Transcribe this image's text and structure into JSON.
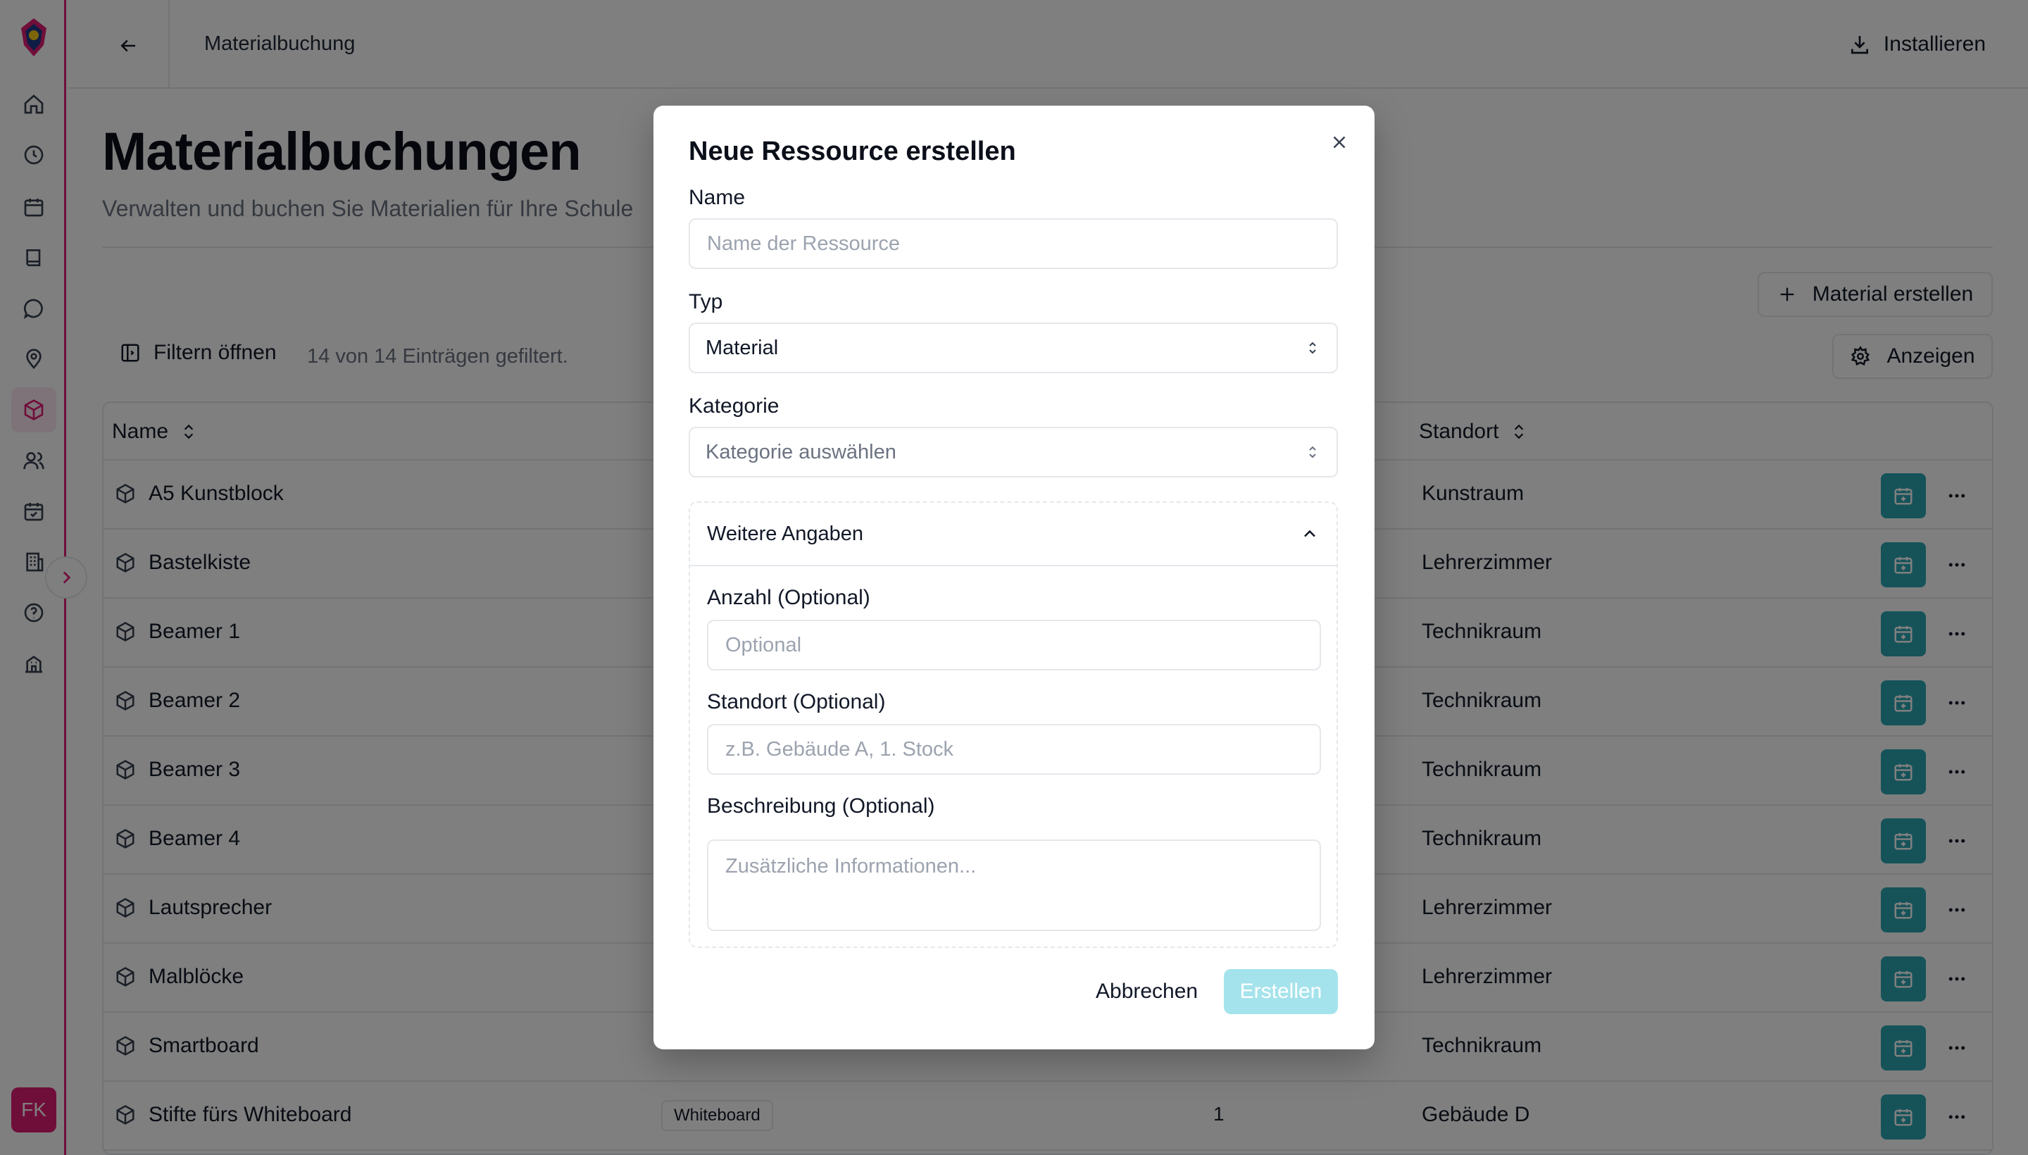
{
  "topbar": {
    "title": "Materialbuchung",
    "install_label": "Installieren"
  },
  "page": {
    "title": "Materialbuchungen",
    "subtitle": "Verwalten und buchen Sie Materialien für Ihre Schule",
    "create_material_label": "Material erstellen",
    "filter_label": "Filtern öffnen",
    "filter_info": "14 von 14 Einträgen gefiltert.",
    "display_label": "Anzeigen"
  },
  "user": {
    "initials": "FK"
  },
  "table": {
    "headers": {
      "name": "Name",
      "location": "Standort"
    },
    "rows": [
      {
        "name": "A5 Kunstblock",
        "location": "Kunstraum"
      },
      {
        "name": "Bastelkiste",
        "location": "Lehrerzimmer"
      },
      {
        "name": "Beamer 1",
        "location": "Technikraum"
      },
      {
        "name": "Beamer 2",
        "location": "Technikraum"
      },
      {
        "name": "Beamer 3",
        "location": "Technikraum"
      },
      {
        "name": "Beamer 4",
        "location": "Technikraum"
      },
      {
        "name": "Lautsprecher",
        "location": "Lehrerzimmer"
      },
      {
        "name": "Malblöcke",
        "location": "Lehrerzimmer"
      },
      {
        "name": "Smartboard",
        "location": "Technikraum"
      },
      {
        "name": "Stifte fürs Whiteboard",
        "type": "Whiteboard",
        "quantity": "1",
        "location": "Gebäude D"
      }
    ]
  },
  "modal": {
    "title": "Neue Ressource erstellen",
    "name_label": "Name",
    "name_placeholder": "Name der Ressource",
    "type_label": "Typ",
    "type_value": "Material",
    "category_label": "Kategorie",
    "category_placeholder": "Kategorie auswählen",
    "details_title": "Weitere Angaben",
    "quantity_label": "Anzahl  (Optional)",
    "quantity_placeholder": "Optional",
    "location_label": "Standort  (Optional)",
    "location_placeholder": "z.B. Gebäude A, 1. Stock",
    "description_label": "Beschreibung  (Optional)",
    "description_placeholder": "Zusätzliche Informationen...",
    "cancel_label": "Abbrechen",
    "create_label": "Erstellen"
  },
  "colors": {
    "accent": "#e11d74",
    "teal": "#2aa6b3",
    "create_disabled": "#a5e3ec"
  }
}
